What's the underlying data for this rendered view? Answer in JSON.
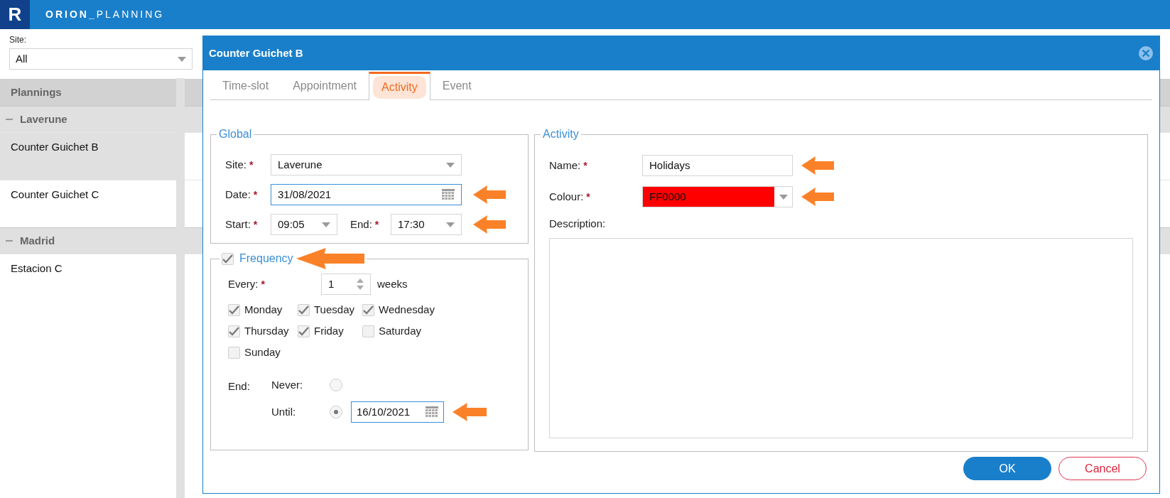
{
  "app": {
    "logo": "R",
    "title": "**ORION_**PLANNING"
  },
  "filter": {
    "label": "Site:",
    "value": "All"
  },
  "plannings": {
    "header": "Plannings",
    "groups": [
      {
        "name": "Laverune",
        "expanded": true,
        "children": [
          {
            "name": "Counter Guichet B",
            "selected": true
          },
          {
            "name": "Counter Guichet C",
            "selected": false
          }
        ]
      },
      {
        "name": "Madrid",
        "expanded": true,
        "children": [
          {
            "name": "Estacion C",
            "selected": false
          }
        ]
      }
    ]
  },
  "dialog": {
    "title": "Counter Guichet B",
    "tabs": [
      {
        "label": "Time-slot",
        "selected": false
      },
      {
        "label": "Appointment",
        "selected": false
      },
      {
        "label": "Activity",
        "selected": true
      },
      {
        "label": "Event",
        "selected": false
      }
    ],
    "global": {
      "legend": "Global",
      "site": {
        "label": "Site:",
        "mark": "*",
        "value": "Laverune"
      },
      "date": {
        "label": "Date:",
        "mark": "*",
        "value": "31/08/2021"
      },
      "start": {
        "label": "Start:",
        "mark": "*",
        "value": "09:05"
      },
      "end": {
        "label": "End:",
        "mark": "*",
        "value": "17:30"
      }
    },
    "frequency": {
      "legend": "Frequency",
      "enabled": true,
      "every": {
        "label": "Every:",
        "mark": "*",
        "value": "1",
        "unit": "weeks"
      },
      "days": [
        {
          "label": "Monday",
          "checked": true
        },
        {
          "label": "Tuesday",
          "checked": true
        },
        {
          "label": "Wednesday",
          "checked": true
        },
        {
          "label": "Thursday",
          "checked": true
        },
        {
          "label": "Friday",
          "checked": true
        },
        {
          "label": "Saturday",
          "checked": false
        },
        {
          "label": "Sunday",
          "checked": false
        }
      ],
      "end_label": "End:",
      "end_options": [
        {
          "label": "Never:",
          "selected": false
        },
        {
          "label": "Until:",
          "selected": true,
          "value": "16/10/2021"
        }
      ]
    },
    "activity": {
      "legend": "Activity",
      "name": {
        "label": "Name:",
        "mark": "*",
        "value": "Holidays"
      },
      "colour": {
        "label": "Colour:",
        "mark": "*",
        "value": "FF0000",
        "color": "#ff0000"
      },
      "description": {
        "label": "Description:"
      }
    },
    "buttons": [
      {
        "label": "OK",
        "kind": "primary"
      },
      {
        "label": "Cancel",
        "kind": "secondary"
      }
    ]
  }
}
